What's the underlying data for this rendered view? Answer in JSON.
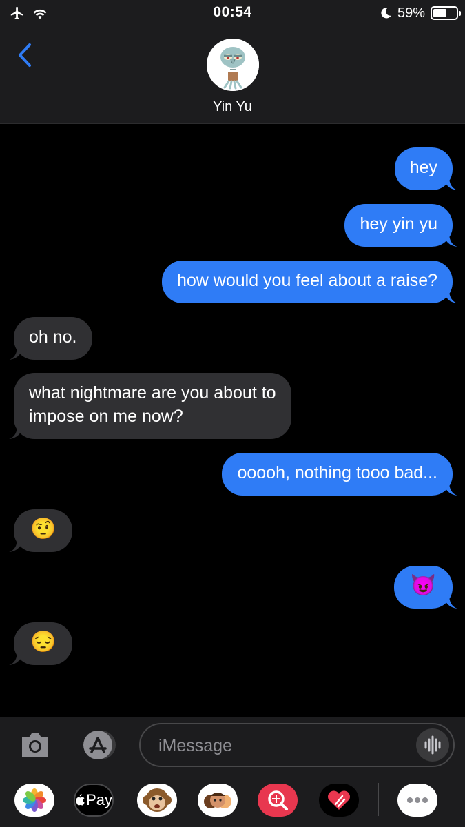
{
  "status_bar": {
    "time": "00:54",
    "battery_percent": "59%",
    "battery_level": 0.59,
    "icons": [
      "airplane-icon",
      "wifi-icon",
      "moon-icon",
      "battery-icon"
    ]
  },
  "header": {
    "contact_name": "Yin Yu",
    "back_icon": "chevron-left-icon",
    "avatar": "squidward-avatar"
  },
  "messages": [
    {
      "from": "me",
      "text": "hey"
    },
    {
      "from": "me",
      "text": "hey yin yu"
    },
    {
      "from": "me",
      "text": "how would you feel about a raise?"
    },
    {
      "from": "them",
      "text": "oh no."
    },
    {
      "from": "them",
      "text": "what nightmare are you about to"
    },
    {
      "from": "them",
      "text": "impose on me now?"
    },
    {
      "from": "me",
      "text": "ooooh, nothing tooo bad..."
    },
    {
      "from": "them",
      "text": "🤨"
    },
    {
      "from": "me",
      "text": "😈"
    },
    {
      "from": "them",
      "text": "😔"
    }
  ],
  "input": {
    "placeholder": "iMessage"
  },
  "apps": {
    "pay_label": "Pay",
    "items": [
      "photos-icon",
      "apple-pay-icon",
      "monkey-animoji-icon",
      "memoji-icon",
      "search-images-icon",
      "digital-touch-icon",
      "more-icon"
    ]
  },
  "colors": {
    "sent_bubble": "#2f7cf6",
    "received_bubble": "#303033",
    "accent": "#2f7cf6"
  }
}
